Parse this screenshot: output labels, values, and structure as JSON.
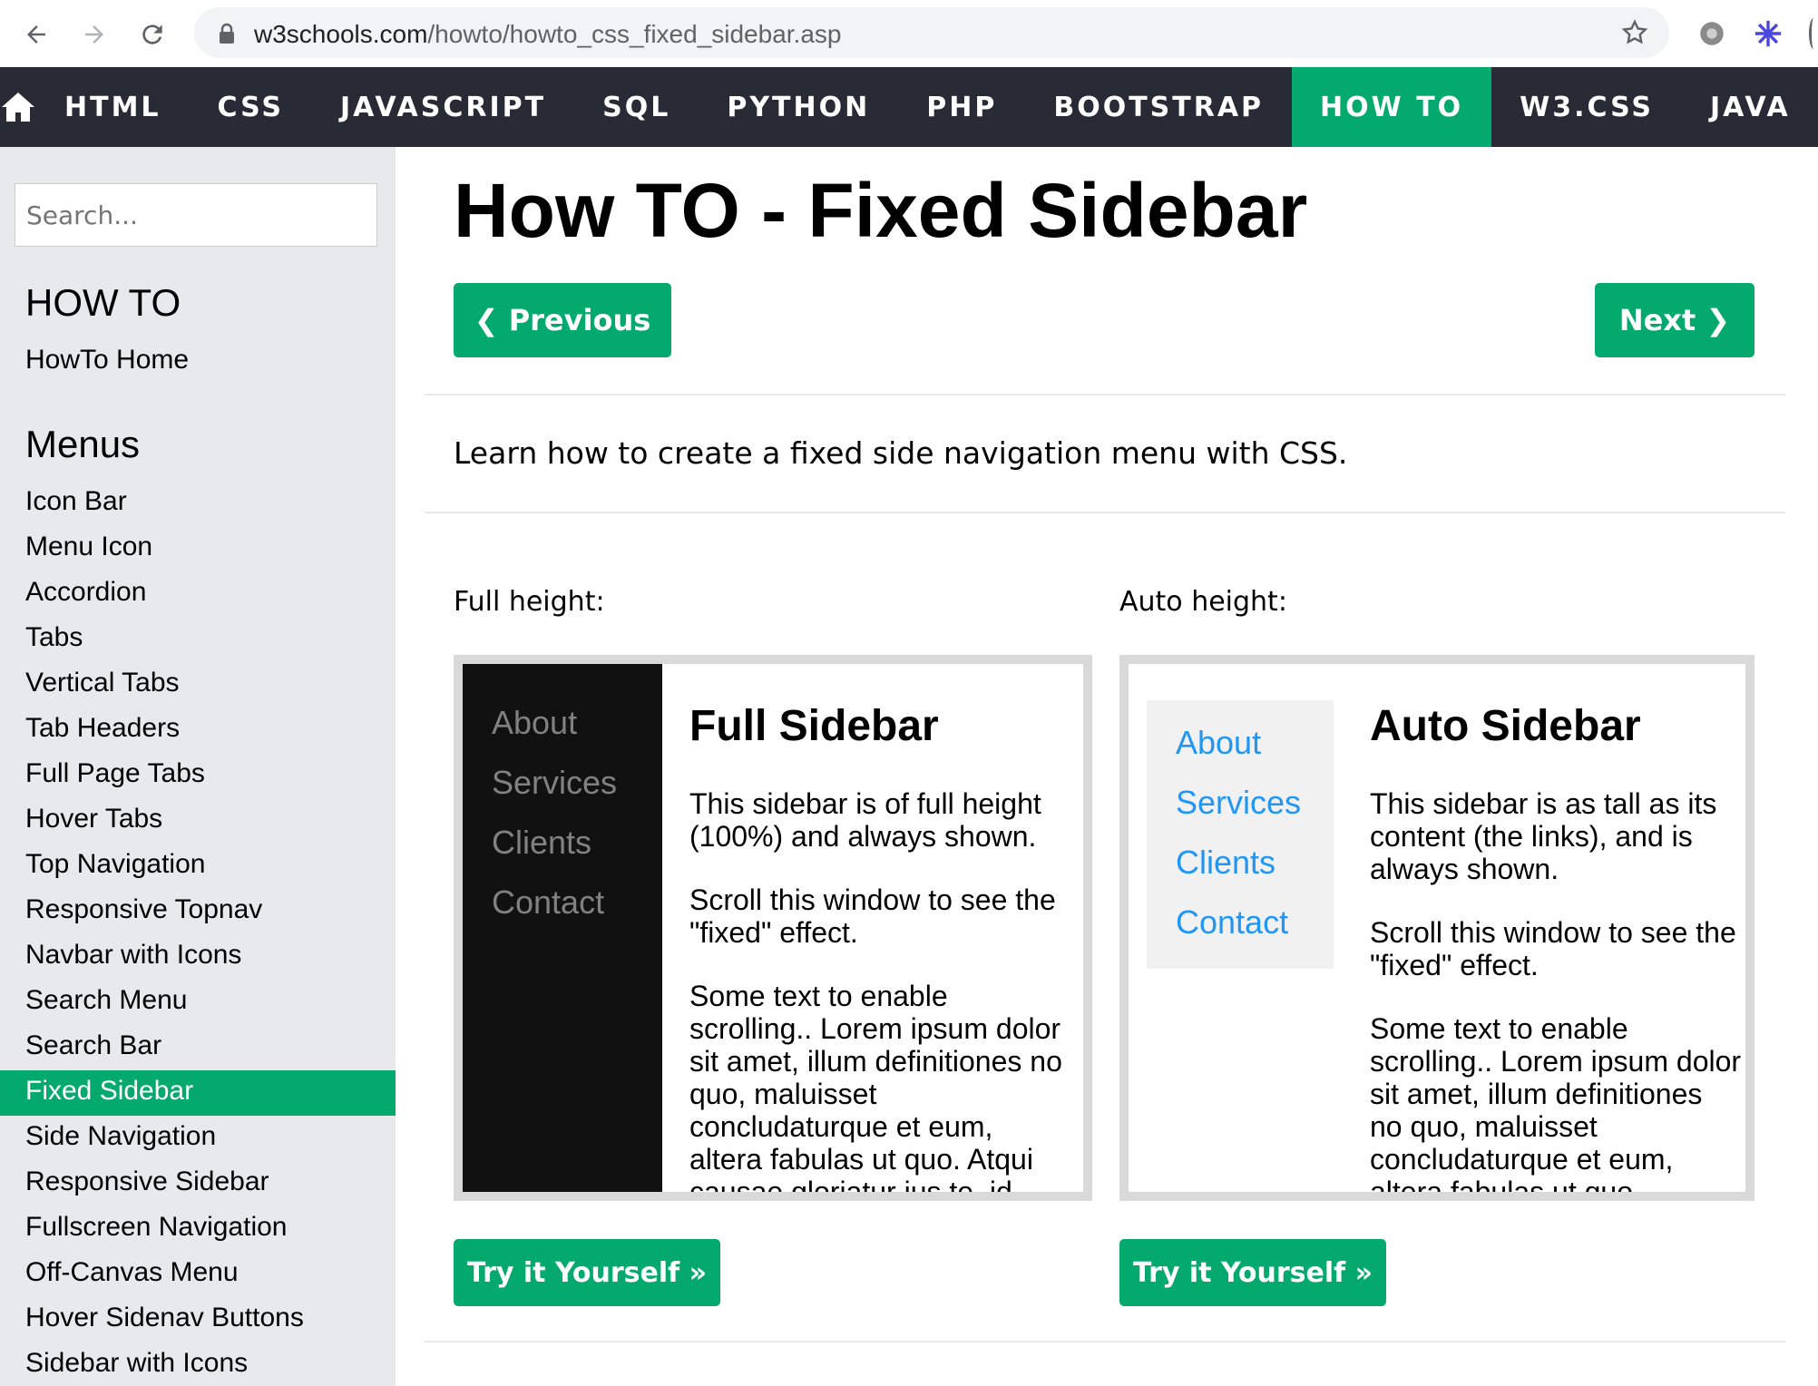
{
  "browser": {
    "url_host": "w3schools.com",
    "url_path": "/howto/howto_css_fixed_sidebar.asp"
  },
  "topnav": {
    "items": [
      {
        "label": "HTML"
      },
      {
        "label": "CSS"
      },
      {
        "label": "JAVASCRIPT"
      },
      {
        "label": "SQL"
      },
      {
        "label": "PYTHON"
      },
      {
        "label": "PHP"
      },
      {
        "label": "BOOTSTRAP"
      },
      {
        "label": "HOW TO",
        "active": true
      },
      {
        "label": "W3.CSS"
      },
      {
        "label": "JAVA"
      }
    ]
  },
  "sidebar": {
    "search_placeholder": "Search...",
    "heading1": "HOW TO",
    "home_link": "HowTo Home",
    "heading2": "Menus",
    "links": [
      "Icon Bar",
      "Menu Icon",
      "Accordion",
      "Tabs",
      "Vertical Tabs",
      "Tab Headers",
      "Full Page Tabs",
      "Hover Tabs",
      "Top Navigation",
      "Responsive Topnav",
      "Navbar with Icons",
      "Search Menu",
      "Search Bar",
      "Fixed Sidebar",
      "Side Navigation",
      "Responsive Sidebar",
      "Fullscreen Navigation",
      "Off-Canvas Menu",
      "Hover Sidenav Buttons",
      "Sidebar with Icons"
    ],
    "active_link": "Fixed Sidebar"
  },
  "main": {
    "title": "How TO - Fixed Sidebar",
    "prev_label": "❮ Previous",
    "next_label": "Next ❯",
    "intro": "Learn how to create a fixed side navigation menu with CSS.",
    "full_label": "Full height:",
    "auto_label": "Auto height:",
    "try_label": "Try it Yourself »"
  },
  "demo_full": {
    "links": [
      "About",
      "Services",
      "Clients",
      "Contact"
    ],
    "heading": "Full Sidebar",
    "p1": "This sidebar is of full height (100%) and always shown.",
    "p2": "Scroll this window to see the \"fixed\" effect.",
    "p3": "Some text to enable scrolling.. Lorem ipsum dolor sit amet, illum definitiones no quo, maluisset concludaturque et eum, altera fabulas ut quo. Atqui causae gloriatur ius te, id"
  },
  "demo_auto": {
    "links": [
      "About",
      "Services",
      "Clients",
      "Contact"
    ],
    "heading": "Auto Sidebar",
    "p1": "This sidebar is as tall as its content (the links), and is always shown.",
    "p2": "Scroll this window to see the \"fixed\" effect.",
    "p3": "Some text to enable scrolling.. Lorem ipsum dolor sit amet, illum definitiones no quo, maluisset concludaturque et eum, altera fabulas ut quo."
  },
  "colors": {
    "accent": "#04aa6d",
    "topnav_bg": "#282a35",
    "sidebar_bg": "#e7e9eb"
  }
}
